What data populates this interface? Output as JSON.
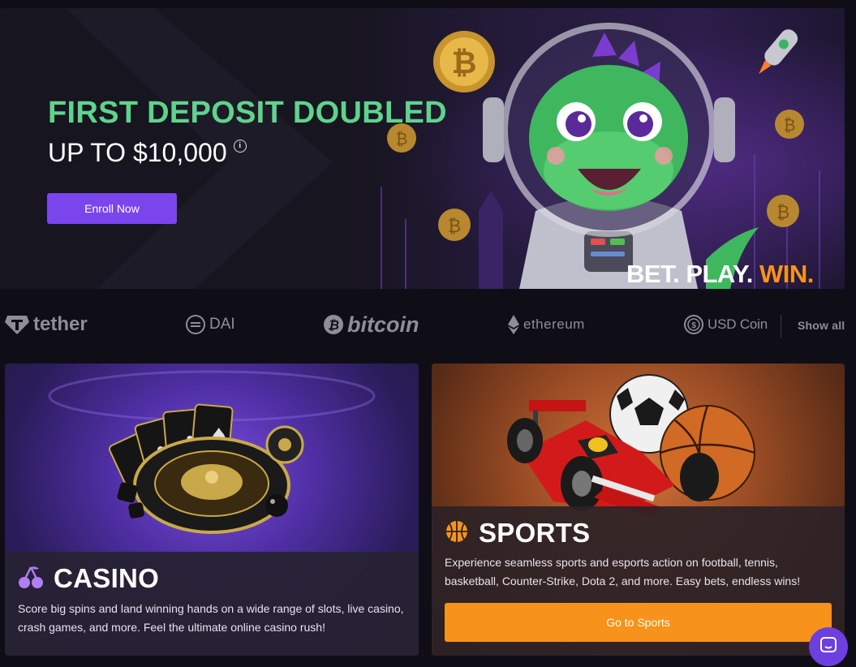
{
  "hero": {
    "title": "FIRST DEPOSIT DOUBLED",
    "subtitle": "UP TO $10,000",
    "info_icon": "info-icon",
    "enroll_label": "Enroll Now",
    "tagline_bet": "BET.",
    "tagline_play": "PLAY.",
    "tagline_win": "WIN."
  },
  "coins": {
    "items": [
      {
        "label": "tether",
        "icon": "tether-icon"
      },
      {
        "label": "DAI",
        "icon": "dai-icon"
      },
      {
        "label": "bitcoin",
        "icon": "bitcoin-icon"
      },
      {
        "label": "ethereum",
        "icon": "ethereum-icon"
      },
      {
        "label": "USD Coin",
        "icon": "usdc-icon"
      }
    ],
    "show_all": "Show all"
  },
  "casino": {
    "icon": "cherries-icon",
    "title": "CASINO",
    "description": "Score big spins and land winning hands on a wide range of slots, live casino, crash games, and more. Feel the ultimate online casino rush!"
  },
  "sports": {
    "icon": "basketball-icon",
    "title": "SPORTS",
    "description": "Experience seamless sports and esports action on football, tennis, basketball, Counter-Strike, Dota 2, and more. Easy bets, endless wins!",
    "button_label": "Go to Sports"
  },
  "colors": {
    "accent_purple": "#7a45ec",
    "accent_green": "#5fd38d",
    "accent_orange": "#f7931a",
    "background": "#0f0e17"
  },
  "chat": {
    "icon": "chat-icon"
  }
}
